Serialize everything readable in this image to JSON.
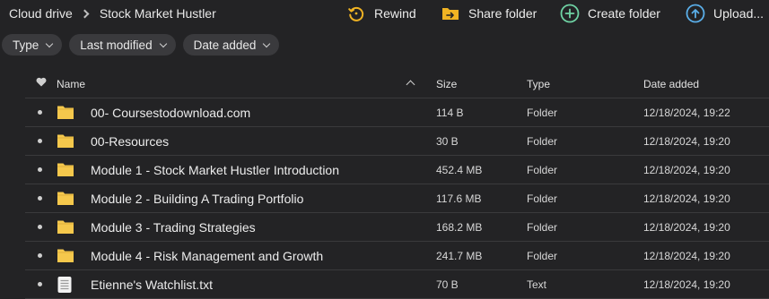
{
  "breadcrumb": {
    "root": "Cloud drive",
    "current": "Stock Market Hustler"
  },
  "actions": {
    "rewind": "Rewind",
    "share_folder": "Share folder",
    "create_folder": "Create folder",
    "upload": "Upload..."
  },
  "filters": {
    "type": "Type",
    "last_modified": "Last modified",
    "date_added": "Date added"
  },
  "table": {
    "columns": {
      "name": "Name",
      "size": "Size",
      "type": "Type",
      "date_added": "Date added"
    },
    "rows": [
      {
        "icon": "folder-icon",
        "name": "00- Coursestodownload.com",
        "size": "114 B",
        "type": "Folder",
        "date": "12/18/2024, 19:22"
      },
      {
        "icon": "folder-icon",
        "name": "00-Resources",
        "size": "30 B",
        "type": "Folder",
        "date": "12/18/2024, 19:20"
      },
      {
        "icon": "folder-icon",
        "name": "Module 1 - Stock Market Hustler Introduction",
        "size": "452.4 MB",
        "type": "Folder",
        "date": "12/18/2024, 19:20"
      },
      {
        "icon": "folder-icon",
        "name": "Module 2 - Building A Trading Portfolio",
        "size": "117.6 MB",
        "type": "Folder",
        "date": "12/18/2024, 19:20"
      },
      {
        "icon": "folder-icon",
        "name": "Module 3 - Trading Strategies",
        "size": "168.2 MB",
        "type": "Folder",
        "date": "12/18/2024, 19:20"
      },
      {
        "icon": "folder-icon",
        "name": "Module 4 - Risk Management and Growth",
        "size": "241.7 MB",
        "type": "Folder",
        "date": "12/18/2024, 19:20"
      },
      {
        "icon": "text-file-icon",
        "name": "Etienne's Watchlist.txt",
        "size": "70 B",
        "type": "Text",
        "date": "12/18/2024, 19:20"
      }
    ]
  },
  "colors": {
    "background": "#232325",
    "chip": "#3a3a3d",
    "folder": "#f5c84c",
    "rewind_icon": "#f0b323",
    "share_icon": "#f0b323",
    "create_icon": "#6fd3a4",
    "upload_icon": "#5aaee8"
  }
}
